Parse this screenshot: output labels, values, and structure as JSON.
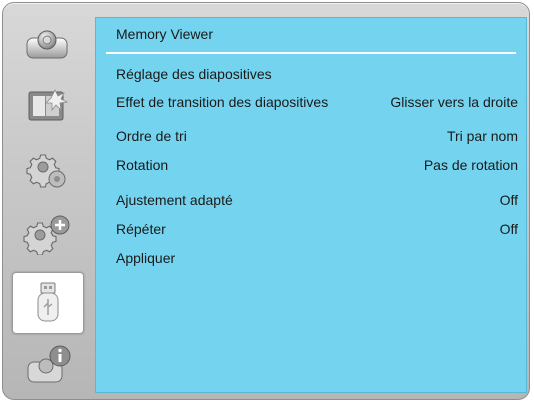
{
  "sidebar": {
    "items": [
      {
        "icon": "projector-icon",
        "active": false
      },
      {
        "icon": "picture-adjust-icon",
        "active": false
      },
      {
        "icon": "gear-icon",
        "active": false
      },
      {
        "icon": "advanced-gear-icon",
        "active": false
      },
      {
        "icon": "usb-memory-icon",
        "active": true
      },
      {
        "icon": "info-icon",
        "active": false
      }
    ]
  },
  "panel": {
    "title": "Memory Viewer",
    "rows": [
      {
        "label": "Réglage des diapositives",
        "value": ""
      },
      {
        "label": "Effet de transition des diapositives",
        "value": "Glisser vers la droite"
      },
      {
        "label": "Ordre de tri",
        "value": "Tri par nom"
      },
      {
        "label": "Rotation",
        "value": "Pas de rotation"
      },
      {
        "label": "Ajustement adapté",
        "value": "Off"
      },
      {
        "label": "Répéter",
        "value": "Off"
      },
      {
        "label": "Appliquer",
        "value": ""
      }
    ]
  },
  "colors": {
    "panel_bg": "#74d4ef",
    "frame_bg": "#c9c9c9",
    "active_item_bg": "#ffffff"
  }
}
